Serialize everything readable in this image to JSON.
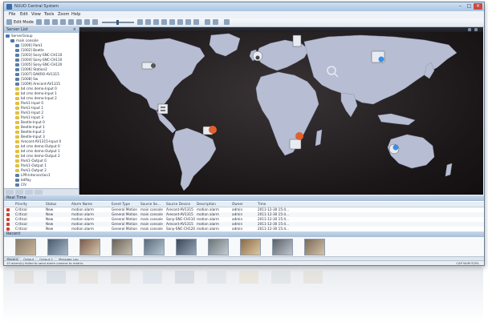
{
  "window": {
    "title": "NUUO Central System",
    "controls": [
      "–",
      "□",
      "×"
    ]
  },
  "menu": [
    "File",
    "Edit",
    "View",
    "Tools",
    "Zoom",
    "Help"
  ],
  "toolbar": {
    "edit_mode_label": "Edit Mode"
  },
  "server_list": {
    "header": "Server List",
    "items": [
      "ServerGroup",
      "main console",
      "[1000] Park1",
      "[1002] Beetle",
      "[1003] Sony-SNC-CH110",
      "[1004] Sony-SNC-CH110",
      "[1005] Sony-SNC-CH120",
      "[1006] Station2",
      "[1007] DAKRO-AV1315",
      "[1008] Sw",
      "[1009] Arecont-AV1315",
      "bd cms demo-Input 0",
      "bd cms demo-Input 1",
      "bd cms demo-Input 2",
      "Park1-Input 0",
      "Park1-Input 1",
      "Park1-Input 2",
      "Park1-Input 3",
      "Beetle-Input 0",
      "Beetle-Input 1",
      "Beetle-Input 2",
      "Beetle-Input 3",
      "Arecont-AV1315-Input 0",
      "bd cms demo-Output 0",
      "bd cms demo-Output 1",
      "bd cms demo-Output 2",
      "Park1-Output 0",
      "Park1-Output 1",
      "Park1-Output 2",
      "LPR-Intersection1",
      "bdPay",
      "CIV"
    ]
  },
  "realtime": {
    "header": "Real Time",
    "columns": [
      "Priority",
      "Status",
      "Alarm Name",
      "Event Type",
      "Source Se...",
      "Source Device",
      "Description",
      "Owner",
      "Time"
    ],
    "rows": [
      [
        "Critical",
        "New",
        "motion alarm",
        "General Motion",
        "main console",
        "Arecont-AV1315",
        "motion alarm",
        "admin",
        "2011-12-30 15:4..."
      ],
      [
        "Critical",
        "New",
        "motion alarm",
        "General Motion",
        "main console",
        "Arecont-AV1315",
        "motion alarm",
        "admin",
        "2011-12-30 15:4..."
      ],
      [
        "Critical",
        "New",
        "motion alarm",
        "General Motion",
        "main console",
        "Sony-SNC-CH110",
        "motion alarm",
        "admin",
        "2011-12-30 15:4..."
      ],
      [
        "Critical",
        "New",
        "motion alarm",
        "General Motion",
        "main console",
        "Arecont-AV1315",
        "motion alarm",
        "admin",
        "2011-12-30 15:4..."
      ],
      [
        "Critical",
        "New",
        "motion alarm",
        "General Motion",
        "main console",
        "Sony-SNC-CH120",
        "motion alarm",
        "admin",
        "2011-12-30 15:4..."
      ],
      [
        "Critical",
        "Auto Close",
        "motion alarm",
        "General Motion",
        "main console",
        "Arecont-AV1315",
        "motion alarm",
        "admin",
        "2011-12-30 15:4..."
      ]
    ]
  },
  "recent": {
    "header": "Recent"
  },
  "bottom_tabs": [
    "Recent",
    "Output",
    "Output 2",
    "Message Log"
  ],
  "status": {
    "message": "15 alarm(s) failed to send alarm camera to matrix.",
    "right": "CAP  NUM  SCRL"
  },
  "colors": {
    "accent": "#3a6ea8",
    "map_bg": "#1b1718",
    "land": "#b7bdd2",
    "alert": "#e06030",
    "info": "#3a8ee8"
  }
}
